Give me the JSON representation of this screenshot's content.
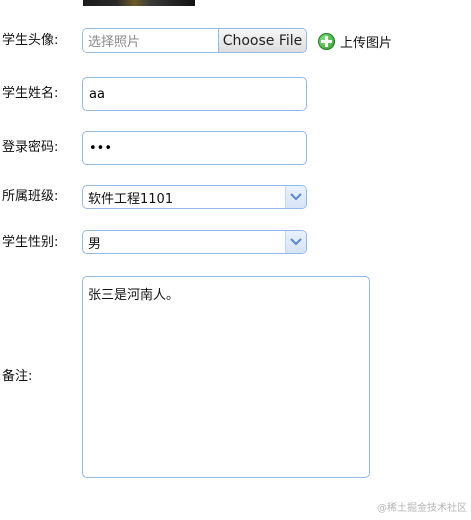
{
  "form": {
    "avatar": {
      "label": "学生头像:",
      "placeholder": "选择照片",
      "choose_file": "Choose File",
      "upload_label": "上传图片"
    },
    "name": {
      "label": "学生姓名:",
      "value": "aa"
    },
    "password": {
      "label": "登录密码:",
      "value": "•••"
    },
    "class": {
      "label": "所属班级:",
      "selected": "软件工程1101"
    },
    "gender": {
      "label": "学生性别:",
      "selected": "男"
    },
    "remark": {
      "label": "备注:",
      "value": "张三是河南人。"
    }
  },
  "watermark": "@稀土掘金技术社区",
  "colors": {
    "input_border": "#95b8e7",
    "icon_green": "#2b9a2a"
  }
}
